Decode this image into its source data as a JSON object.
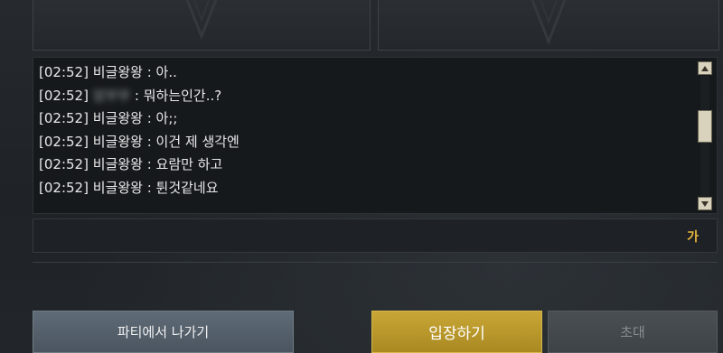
{
  "chat": {
    "lines": [
      {
        "time": "[02:52]",
        "nick": "비글왕왕",
        "sep": " : ",
        "text": "아.."
      },
      {
        "time": "[02:52]",
        "nick": "암부부",
        "sep": " : ",
        "text": "뭐하는인간..?"
      },
      {
        "time": "[02:52]",
        "nick": "비글왕왕",
        "sep": " : ",
        "text": "아;;"
      },
      {
        "time": "[02:52]",
        "nick": "비글왕왕",
        "sep": " : ",
        "text": "이건 제 생각엔"
      },
      {
        "time": "[02:52]",
        "nick": "비글왕왕",
        "sep": " : ",
        "text": "요람만 하고"
      },
      {
        "time": "[02:52]",
        "nick": "비글왕왕",
        "sep": " : ",
        "text": "튄것같네요"
      }
    ]
  },
  "input": {
    "value": "",
    "ime_mode": "가"
  },
  "buttons": {
    "leave": "파티에서 나가기",
    "enter": "입장하기",
    "invite": "초대"
  },
  "colors": {
    "accent_gold": "#c9a636",
    "ime_gold": "#e8b63a",
    "button_slate": "#5f6b76",
    "button_disabled": "#44494e"
  }
}
